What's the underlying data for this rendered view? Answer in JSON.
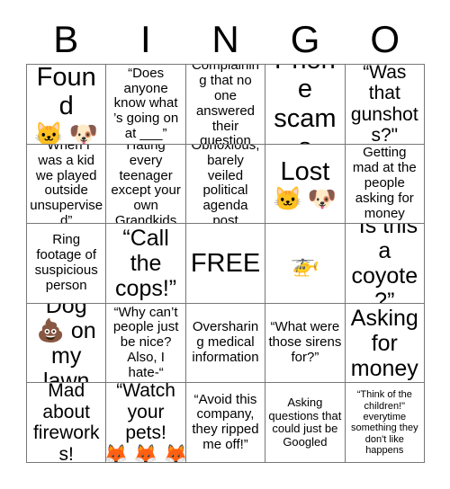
{
  "card": {
    "title": "BINGO",
    "header_letters": [
      "B",
      "I",
      "N",
      "G",
      "O"
    ],
    "grid_size": "5x5",
    "free_space": "FREE",
    "colors": {
      "background": "#ffffff",
      "text": "#000000",
      "grid_line": "#777777"
    },
    "cells": [
      {
        "id": "b1",
        "text": "Found",
        "emojis": [
          "🐱",
          "🐶"
        ],
        "emoji_names": [
          "cat-face-emoji",
          "dog-face-emoji"
        ],
        "size": "fs-xxl"
      },
      {
        "id": "i1",
        "text": "“Does anyone know what ’s going on at ___”",
        "emojis": [],
        "emoji_names": [],
        "size": "fs-md"
      },
      {
        "id": "n1",
        "text": "Complaining that no one answered their question",
        "emojis": [],
        "emoji_names": [],
        "size": "fs-md"
      },
      {
        "id": "g1",
        "text": "Phone scams",
        "emojis": [],
        "emoji_names": [],
        "size": "fs-xxl"
      },
      {
        "id": "o1",
        "text": "“Was that gunshots?\"",
        "emojis": [],
        "emoji_names": [],
        "size": "fs-lg"
      },
      {
        "id": "b2",
        "text": "“When I was a kid we played outside unsupervised”",
        "emojis": [],
        "emoji_names": [],
        "size": "fs-md"
      },
      {
        "id": "i2",
        "text": "Hating every teenager except your own Grandkids",
        "emojis": [],
        "emoji_names": [],
        "size": "fs-md"
      },
      {
        "id": "n2",
        "text": "Obnoxious, barely veiled political agenda post",
        "emojis": [],
        "emoji_names": [],
        "size": "fs-md"
      },
      {
        "id": "g2",
        "text": "Lost",
        "emojis": [
          "🐱",
          "🐶"
        ],
        "emoji_names": [
          "cat-face-emoji",
          "dog-face-emoji"
        ],
        "size": "fs-xxl"
      },
      {
        "id": "o2",
        "text": "Getting mad at the people asking for money",
        "emojis": [],
        "emoji_names": [],
        "size": "fs-md"
      },
      {
        "id": "b3",
        "text": "Ring footage of suspicious person",
        "emojis": [],
        "emoji_names": [],
        "size": "fs-md"
      },
      {
        "id": "i3",
        "text": "“Call the cops!”",
        "emojis": [],
        "emoji_names": [],
        "size": "fs-xl"
      },
      {
        "id": "n3",
        "text": "FREE",
        "emojis": [],
        "emoji_names": [],
        "size": "fs-xxl"
      },
      {
        "id": "g3",
        "text": "",
        "emojis": [
          "🚁"
        ],
        "emoji_names": [
          "helicopter-emoji"
        ],
        "size": "fs-xxl"
      },
      {
        "id": "o3",
        "text": "“Is this a coyote?”",
        "emojis": [],
        "emoji_names": [],
        "size": "fs-xl"
      },
      {
        "id": "b4",
        "text": "Dog 💩 on my lawn",
        "emojis": [],
        "emoji_names": [
          "poop-emoji"
        ],
        "size": "fs-xl"
      },
      {
        "id": "i4",
        "text": "“Why can’t people just be nice? Also, I hate-“",
        "emojis": [],
        "emoji_names": [],
        "size": "fs-md"
      },
      {
        "id": "n4",
        "text": "Oversharing medical information",
        "emojis": [],
        "emoji_names": [],
        "size": "fs-md"
      },
      {
        "id": "g4",
        "text": "“What were those sirens for?”",
        "emojis": [],
        "emoji_names": [],
        "size": "fs-md"
      },
      {
        "id": "o4",
        "text": "Asking for money",
        "emojis": [],
        "emoji_names": [],
        "size": "fs-xl"
      },
      {
        "id": "b5",
        "text": "Mad about fireworks!",
        "emojis": [],
        "emoji_names": [],
        "size": "fs-lg"
      },
      {
        "id": "i5",
        "text": "“Watch your pets!",
        "emojis": [
          "🦊",
          "🦊",
          "🦊"
        ],
        "emoji_names": [
          "fox-emoji",
          "fox-emoji",
          "fox-emoji"
        ],
        "size": "fs-lg"
      },
      {
        "id": "n5",
        "text": "“Avoid this company, they ripped me off!”",
        "emojis": [],
        "emoji_names": [],
        "size": "fs-md"
      },
      {
        "id": "g5",
        "text": "Asking questions that could just be Googled",
        "emojis": [],
        "emoji_names": [],
        "size": "fs-sm"
      },
      {
        "id": "o5",
        "text": "“Think of the children!\" everytime something they don't like happens",
        "emojis": [],
        "emoji_names": [],
        "size": "fs-xs"
      }
    ]
  }
}
